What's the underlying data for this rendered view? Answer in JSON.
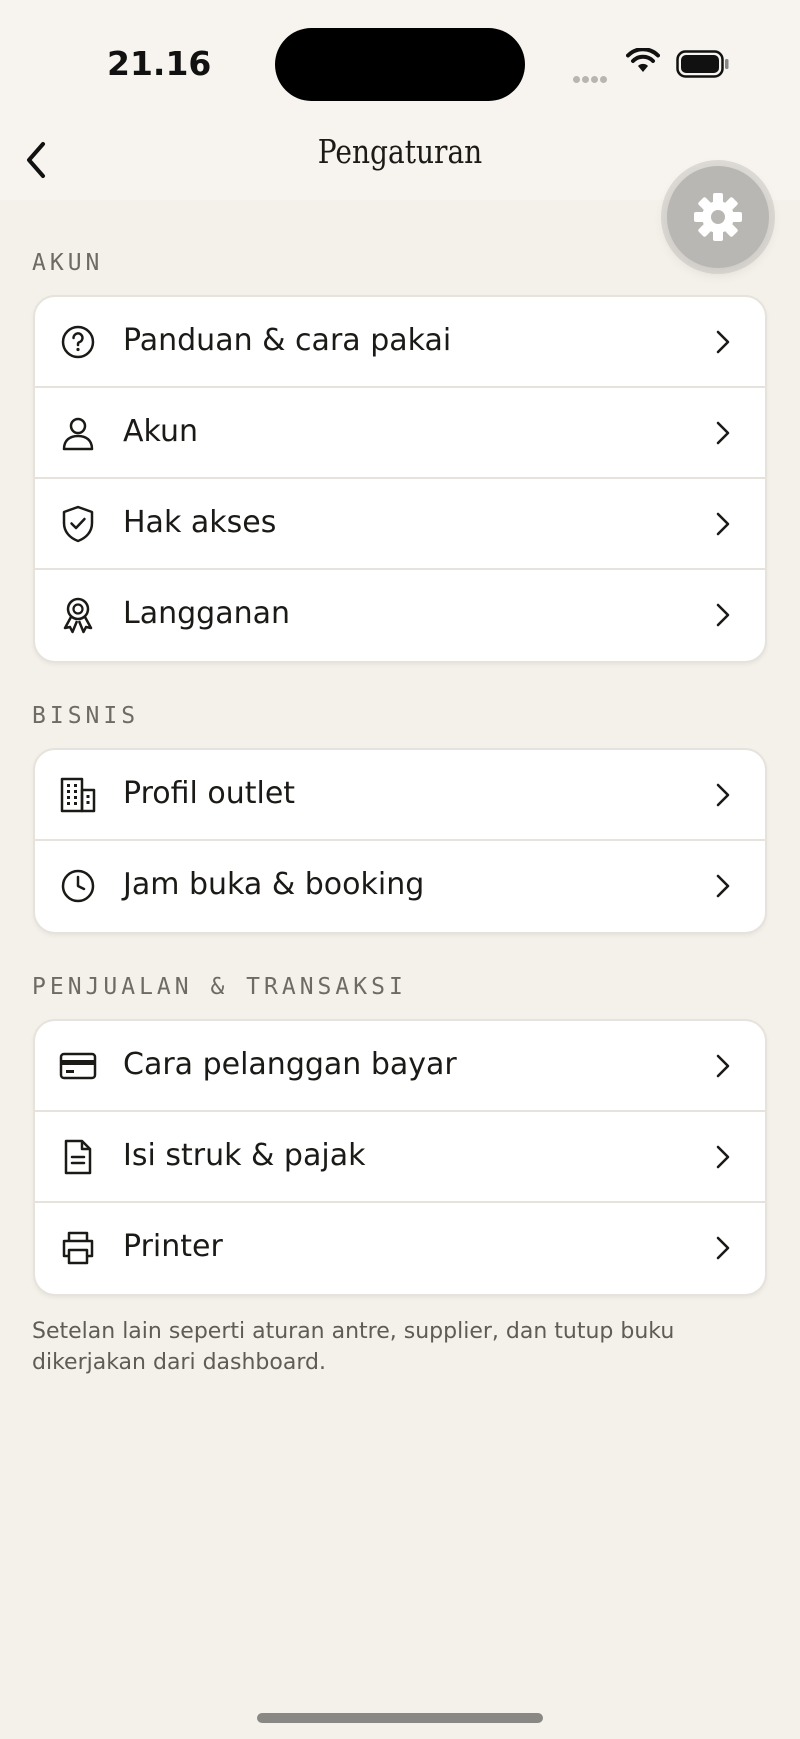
{
  "status_bar": {
    "time": "21.16"
  },
  "nav": {
    "title": "Pengaturan"
  },
  "sections": [
    {
      "label": "AKUN",
      "items": [
        {
          "label": "Panduan & cara pakai",
          "icon": "help-circle-icon"
        },
        {
          "label": "Akun",
          "icon": "user-icon"
        },
        {
          "label": "Hak akses",
          "icon": "shield-check-icon"
        },
        {
          "label": "Langganan",
          "icon": "award-icon"
        }
      ]
    },
    {
      "label": "BISNIS",
      "items": [
        {
          "label": "Profil outlet",
          "icon": "building-icon"
        },
        {
          "label": "Jam buka & booking",
          "icon": "clock-icon"
        }
      ]
    },
    {
      "label": "PENJUALAN & TRANSAKSI",
      "items": [
        {
          "label": "Cara pelanggan bayar",
          "icon": "credit-card-icon"
        },
        {
          "label": "Isi struk & pajak",
          "icon": "receipt-icon"
        },
        {
          "label": "Printer",
          "icon": "printer-icon"
        }
      ]
    }
  ],
  "footer_note": "Setelan lain seperti aturan antre, supplier, dan tutup buku dikerjakan dari dashboard."
}
